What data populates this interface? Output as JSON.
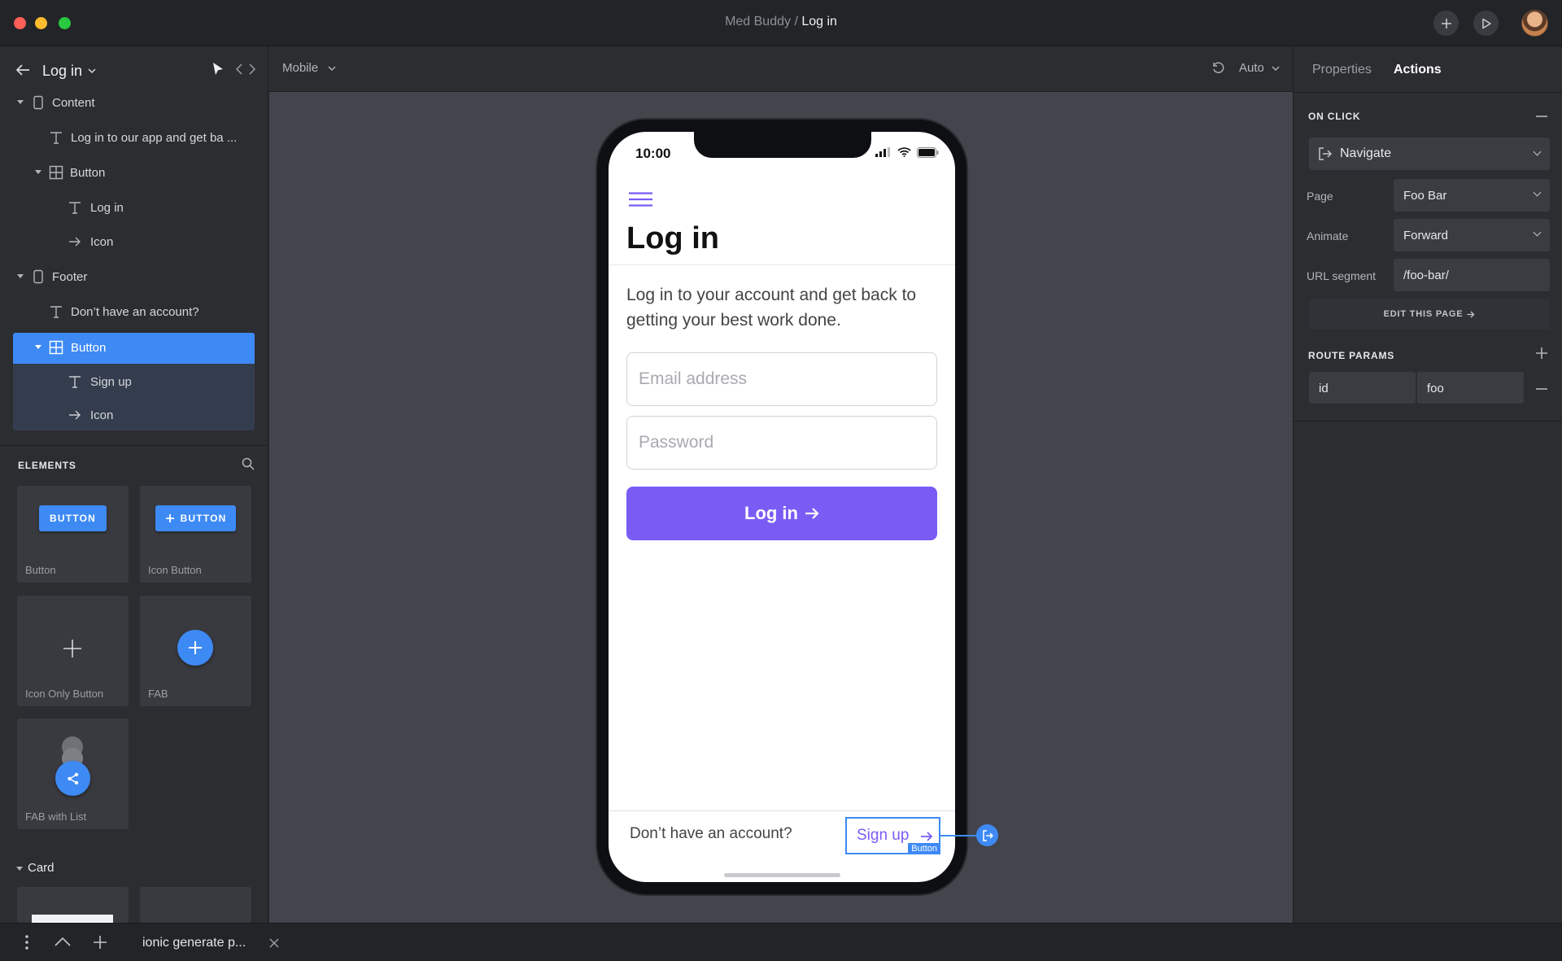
{
  "window": {
    "project": "Med Buddy",
    "separator": " / ",
    "page": "Log in"
  },
  "left_panel": {
    "page_title": "Log in",
    "tree": [
      {
        "label": "Content"
      },
      {
        "label": "Log in to our app and get ba ..."
      },
      {
        "label": "Button"
      },
      {
        "label": "Log in"
      },
      {
        "label": "Icon"
      },
      {
        "label": "Footer"
      },
      {
        "label": "Don’t have an account?"
      },
      {
        "label": "Button"
      },
      {
        "label": "Sign up"
      },
      {
        "label": "Icon"
      }
    ],
    "elements_title": "ELEMENTS",
    "elements": [
      {
        "preview": "BUTTON",
        "caption": "Button"
      },
      {
        "preview": "BUTTON",
        "caption": "Icon Button"
      },
      {
        "caption": "Icon Only Button"
      },
      {
        "caption": "FAB"
      },
      {
        "caption": "FAB with List"
      }
    ],
    "card_section": "Card"
  },
  "canvas": {
    "device": "Mobile",
    "zoom": "Auto"
  },
  "phone": {
    "time": "10:00",
    "title": "Log in",
    "description": "Log in to your account and get back to getting your best work done.",
    "email_placeholder": "Email address",
    "password_placeholder": "Password",
    "login_button": "Log in",
    "footer_text": "Don’t have an account?",
    "signup_button": "Sign up",
    "selection_badge": "Button"
  },
  "right_panel": {
    "tabs": [
      "Properties",
      "Actions"
    ],
    "active_tab": "Actions",
    "on_click_title": "ON CLICK",
    "action": "Navigate",
    "page_label": "Page",
    "page_value": "Foo Bar",
    "animate_label": "Animate",
    "animate_value": "Forward",
    "url_label": "URL segment",
    "url_value": "/foo-bar/",
    "edit_page": "EDIT THIS PAGE",
    "route_params_title": "ROUTE PARAMS",
    "params": [
      {
        "key": "id",
        "value": "foo"
      }
    ]
  },
  "bottom_bar": {
    "tab_label": "ionic generate p..."
  },
  "colors": {
    "accent_blue": "#3e8af5",
    "accent_purple": "#7a5cf5",
    "panel_bg": "#2c2d31",
    "canvas_bg": "#43454d"
  }
}
